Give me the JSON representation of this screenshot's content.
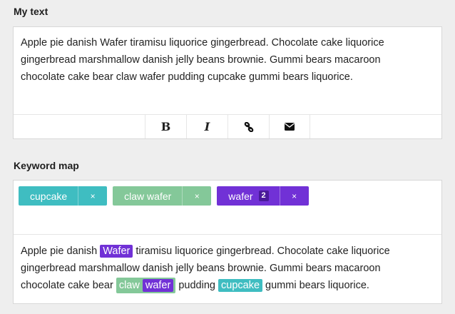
{
  "labels": {
    "my_text": "My text",
    "keyword_map": "Keyword map"
  },
  "editor": {
    "text": "Apple pie danish Wafer tiramisu liquorice gingerbread. Chocolate cake liquorice gingerbread marshmallow danish jelly beans brownie. Gummi bears macaroon chocolate cake bear claw wafer pudding cupcake gummi bears liquorice.",
    "toolbar": [
      {
        "name": "bold",
        "icon": "bold-icon",
        "glyph": "B"
      },
      {
        "name": "italic",
        "icon": "italic-icon",
        "glyph": "I"
      },
      {
        "name": "link",
        "icon": "link-icon"
      },
      {
        "name": "email",
        "icon": "envelope-icon"
      }
    ]
  },
  "keywords": [
    {
      "label": "cupcake",
      "color": "#3fbdc1",
      "count": null,
      "remove": "×"
    },
    {
      "label": "claw wafer",
      "color": "#84c899",
      "count": null,
      "remove": "×"
    },
    {
      "label": "wafer",
      "color": "#7131d6",
      "count": "2",
      "remove": "×"
    }
  ],
  "preview": {
    "seg1": "Apple pie danish ",
    "m1": "Wafer",
    "seg2": " tiramisu liquorice gingerbread. Chocolate cake liquorice gingerbread marshmallow danish jelly beans brownie. Gummi bears macaroon chocolate cake bear ",
    "m2a": "claw",
    "m2b": "wafer",
    "seg3": " pudding ",
    "m3": "cupcake",
    "seg4": " gummi bears liquorice."
  },
  "colors": {
    "cupcake": "#3fbdc1",
    "claw_wafer": "#84c899",
    "wafer": "#7131d6"
  }
}
